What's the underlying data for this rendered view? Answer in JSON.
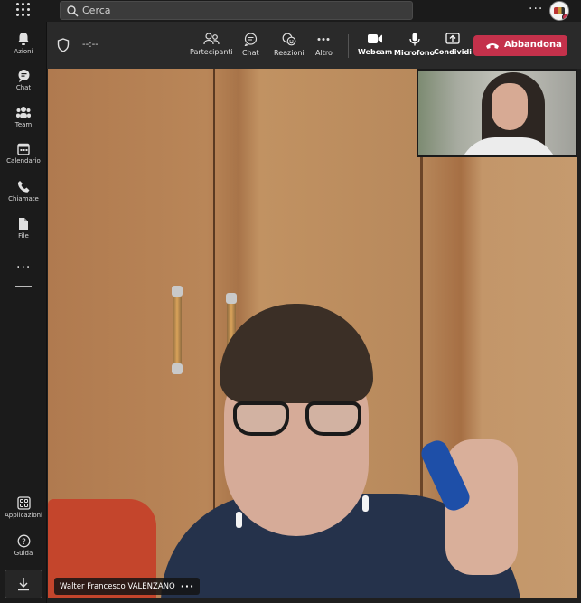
{
  "topbar": {
    "search_placeholder": "Cerca",
    "more_label": "···"
  },
  "rail": {
    "items": [
      {
        "label": "Azioni",
        "icon": "bell-icon"
      },
      {
        "label": "Chat",
        "icon": "chat-icon"
      },
      {
        "label": "Team",
        "icon": "teams-icon"
      },
      {
        "label": "Calendario",
        "icon": "calendar-icon"
      },
      {
        "label": "Chiamate",
        "icon": "phone-icon"
      },
      {
        "label": "File",
        "icon": "file-icon"
      }
    ],
    "more_label": "···",
    "bottom_items": [
      {
        "label": "Applicazioni",
        "icon": "apps-icon"
      },
      {
        "label": "Guida",
        "icon": "help-icon"
      }
    ]
  },
  "call": {
    "timer": "--:--",
    "buttons": {
      "participants": "Partecipanti",
      "chat": "Chat",
      "reactions": "Reazioni",
      "more": "Altro",
      "webcam": "Webcam",
      "microphone": "Microfono",
      "share": "Condividi"
    },
    "leave_label": "Abbandona"
  },
  "video": {
    "participant_name": "Walter Francesco VALENZANO",
    "name_more": "···"
  },
  "colors": {
    "leave": "#c4314b",
    "background": "#1f1f1f",
    "toolbar": "#2a2a2a"
  }
}
